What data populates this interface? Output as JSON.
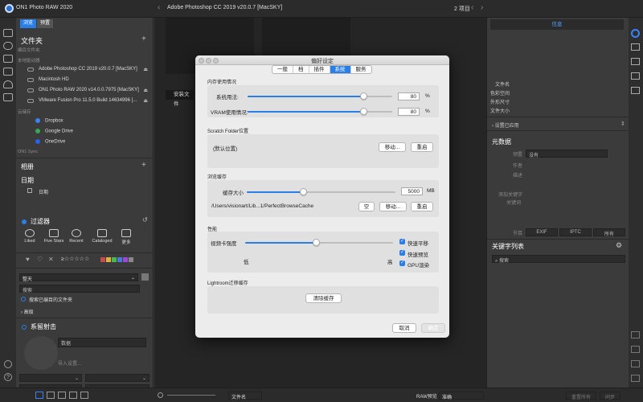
{
  "app": {
    "title": "ON1 Photo RAW 2020",
    "breadcrumb": "Adobe Photoshop CC 2019 v20.0.7 [MacSKY]",
    "page_count": "2 项目"
  },
  "left_panel": {
    "tabs": [
      "浏览",
      "预置"
    ],
    "browse_title": "文件夹",
    "edited_folders": "编目文件夹",
    "local_drives": "本地驱动器",
    "drives": [
      "Adobe Photoshop CC 2019 v20.0.7 [MacSKY]",
      "Macintosh HD",
      "ON1 Photo RAW 2020 v14.0.0.7975 [MacSKY]",
      "VMware Fusion Pro 11.5.0 Build 14634996 [..."
    ],
    "cloud_storage": "云储存",
    "clouds": [
      "Dropbox",
      "Google Drive",
      "OneDrive"
    ],
    "sync": "ON1 Sync",
    "albums": "相册",
    "dates": "日期",
    "date_item": "日期",
    "filters": "过滤器",
    "filter_buttons": [
      "Liked",
      "Five Stars",
      "Recent",
      "Cataloged",
      "更多"
    ],
    "dropdown": "整天",
    "search_placeholder": "搜索",
    "search_folders": "搜索已编目的文件夹",
    "advanced": "高级",
    "shoot_title": "系留射击",
    "data_placeholder": "数据",
    "import_settings": "导入设置..."
  },
  "dialog": {
    "title": "偏好设定",
    "tabs": [
      "一般",
      "档",
      "插件",
      "系统",
      "服务"
    ],
    "active_tab": "系统",
    "mem_group": "内存使用情况",
    "sys_usage_label": "系统用法:",
    "sys_usage_value": "80",
    "sys_usage_pct": 80,
    "vram_label": "VRAM使用情况:",
    "vram_value": "80",
    "vram_pct": 80,
    "pct": "%",
    "scratch_group": "Scratch Folder位置",
    "scratch_default": "(默认位置)",
    "move": "移动...",
    "reset": "重启",
    "browse_cache_group": "浏览缓存",
    "cache_size_label": "缓存大小",
    "cache_size_value": "5000",
    "cache_size_pct": 38,
    "cache_unit": "MB",
    "cache_path": "/Users/visionart/Lib...1/PerfectBrowseCache",
    "empty": "空",
    "perf_group": "性能",
    "gpu_label": "视频卡强度",
    "gpu_pct": 48,
    "low": "低",
    "high": "高",
    "checks": [
      "快速平移",
      "快速预览",
      "GPU渲染"
    ],
    "lr_group": "Lightroom迁移缓存",
    "clear_cache": "清除缓存",
    "cancel": "取消",
    "ok": "确定",
    "install_text": "安装文件"
  },
  "right_panel": {
    "info_tab": "信息",
    "meta_keys": [
      "文件名",
      "色彩空间",
      "外形尺寸",
      "文件大小"
    ],
    "apply_settings": "设置已应用",
    "metadata_title": "元数据",
    "preset_label": "预置",
    "preset_value": "没有",
    "author": "作者",
    "desc": "描述",
    "add_keywords": "添加关键字",
    "keywords": "关键词",
    "node": "节目",
    "exif": "EXIF",
    "iptc": "IPTC",
    "all": "所有",
    "keyword_list": "关键字列表",
    "search": "搜索"
  },
  "bottom": {
    "sort": "文件名",
    "raw_preview": "RAW预览",
    "raw_mode": "准确",
    "reset_all": "重置所有",
    "sync": "同步"
  }
}
